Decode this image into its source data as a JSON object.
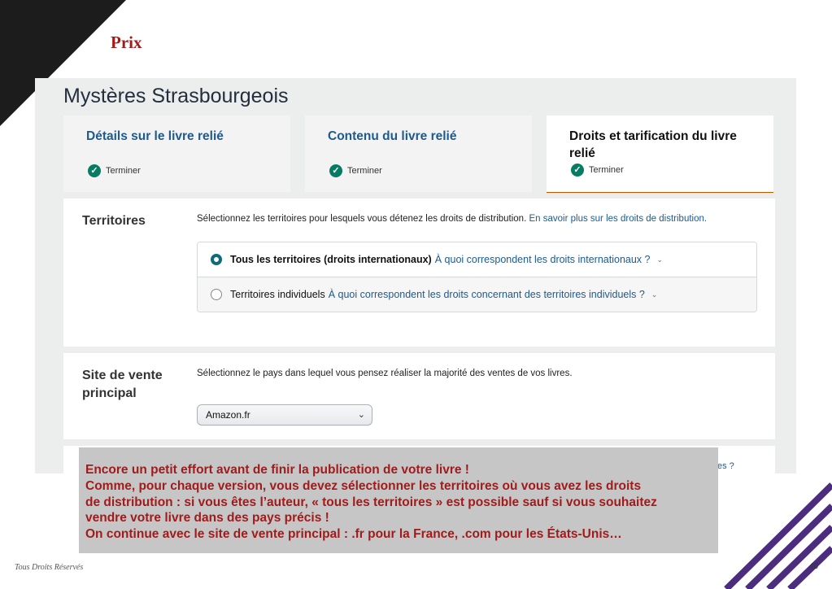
{
  "slide": {
    "title": "Prix",
    "footer": "Tous Droits Réservés",
    "page_number": "40"
  },
  "kdp": {
    "book_title": "Mystères Strasbourgeois",
    "tabs": [
      {
        "label": "Détails sur le livre relié",
        "status": "Terminer"
      },
      {
        "label": "Contenu du livre relié",
        "status": "Terminer"
      },
      {
        "label": "Droits et tarification du livre relié",
        "status": "Terminer"
      }
    ],
    "territories": {
      "label": "Territoires",
      "helper": "Sélectionnez les territoires pour lesquels vous détenez les droits de distribution.",
      "helper_link": "En savoir plus sur les droits de distribution.",
      "options": [
        {
          "label": "Tous les territoires (droits internationaux)",
          "link": "À quoi correspondent les droits internationaux ?",
          "selected": true
        },
        {
          "label": "Territoires individuels",
          "link": "À quoi correspondent les droits concernant des territoires individuels ?",
          "selected": false
        }
      ]
    },
    "marketplace": {
      "label_line1": "Site de vente",
      "label_line2": "principal",
      "helper": "Sélectionnez le pays dans lequel vous pensez réaliser la majorité des ventes de vos livres.",
      "selected_value": "Amazon.fr"
    },
    "partial_link": "es ?"
  },
  "annotation": {
    "lines": [
      "Encore un petit effort avant de finir la publication de votre livre !",
      "Comme, pour chaque version, vous devez sélectionner les territoires où vous avez les droits",
      "de distribution : si vous êtes l’auteur, « tous les territoires » est possible sauf si vous souhaitez",
      "vendre votre livre dans des pays précis !",
      "On continue avec le site de vente principal : .fr pour la France, .com pour les États-Unis…"
    ]
  },
  "colors": {
    "title_red": "#a01c1c",
    "kdp_link": "#1d5a8e",
    "check_green": "#067d62",
    "radio_teal": "#0e6b7a",
    "stripe_purple": "#4b2c7f",
    "annotation_bg": "#c6c6c6"
  }
}
